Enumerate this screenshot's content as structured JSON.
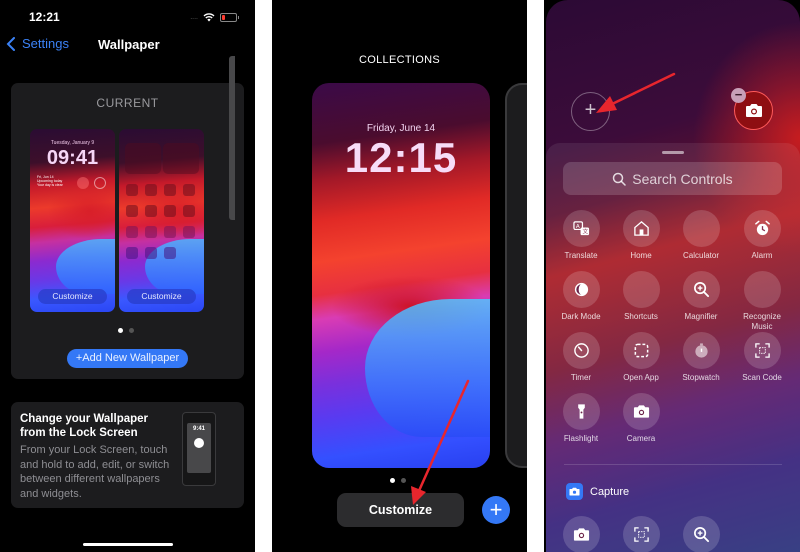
{
  "panel1": {
    "status_bar": {
      "time": "12:21",
      "signal": "....",
      "battery_color": "#ff3b30"
    },
    "nav": {
      "back_label": "Settings",
      "title": "Wallpaper"
    },
    "current": {
      "label": "CURRENT",
      "lock_thumb": {
        "date": "Tuesday, January 9",
        "time": "09:41",
        "widget_lines": [
          "Fri, Jun 14",
          "Upcoming today",
          "Your day is clear"
        ],
        "customize_label": "Customize"
      },
      "home_thumb": {
        "customize_label": "Customize"
      },
      "pages": 2,
      "active_page": 1
    },
    "add_button_label": "+Add New Wallpaper",
    "tip": {
      "title": "Change your Wallpaper from the Lock Screen",
      "body": "From your Lock Screen, touch and hold to add, edit, or switch between different wallpapers and widgets.",
      "phone_time": "9:41"
    }
  },
  "panel2": {
    "header": "COLLECTIONS",
    "wallpaper": {
      "date": "Friday, June 14",
      "time": "12:15"
    },
    "pages": 2,
    "active_page": 1,
    "customize_label": "Customize",
    "add_icon": "+"
  },
  "panel3": {
    "add_slot_icon": "+",
    "remove_badge_icon": "−",
    "search_placeholder": "Search Controls",
    "controls": [
      {
        "label": "Translate",
        "icon": "translate-icon"
      },
      {
        "label": "Home",
        "icon": "home-icon"
      },
      {
        "label": "Calculator",
        "icon": "calculator-icon"
      },
      {
        "label": "Alarm",
        "icon": "alarm-icon"
      },
      {
        "label": "Dark Mode",
        "icon": "dark-mode-icon"
      },
      {
        "label": "Shortcuts",
        "icon": "shortcuts-icon"
      },
      {
        "label": "Magnifier",
        "icon": "magnifier-icon"
      },
      {
        "label": "Recognize Music",
        "icon": "recognize-music-icon"
      },
      {
        "label": "Timer",
        "icon": "timer-icon"
      },
      {
        "label": "Open App",
        "icon": "open-app-icon"
      },
      {
        "label": "Stopwatch",
        "icon": "stopwatch-icon"
      },
      {
        "label": "Scan Code",
        "icon": "scan-code-icon"
      },
      {
        "label": "Flashlight",
        "icon": "flashlight-icon"
      },
      {
        "label": "Camera",
        "icon": "camera-icon"
      }
    ],
    "section": {
      "title": "Capture",
      "items": [
        {
          "icon": "camera-icon"
        },
        {
          "icon": "scan-code-icon"
        },
        {
          "icon": "magnifier-icon"
        }
      ]
    }
  },
  "colors": {
    "accent": "#3478f6",
    "annotation_arrow": "#e8262d",
    "card_bg": "#1c1c1e"
  }
}
